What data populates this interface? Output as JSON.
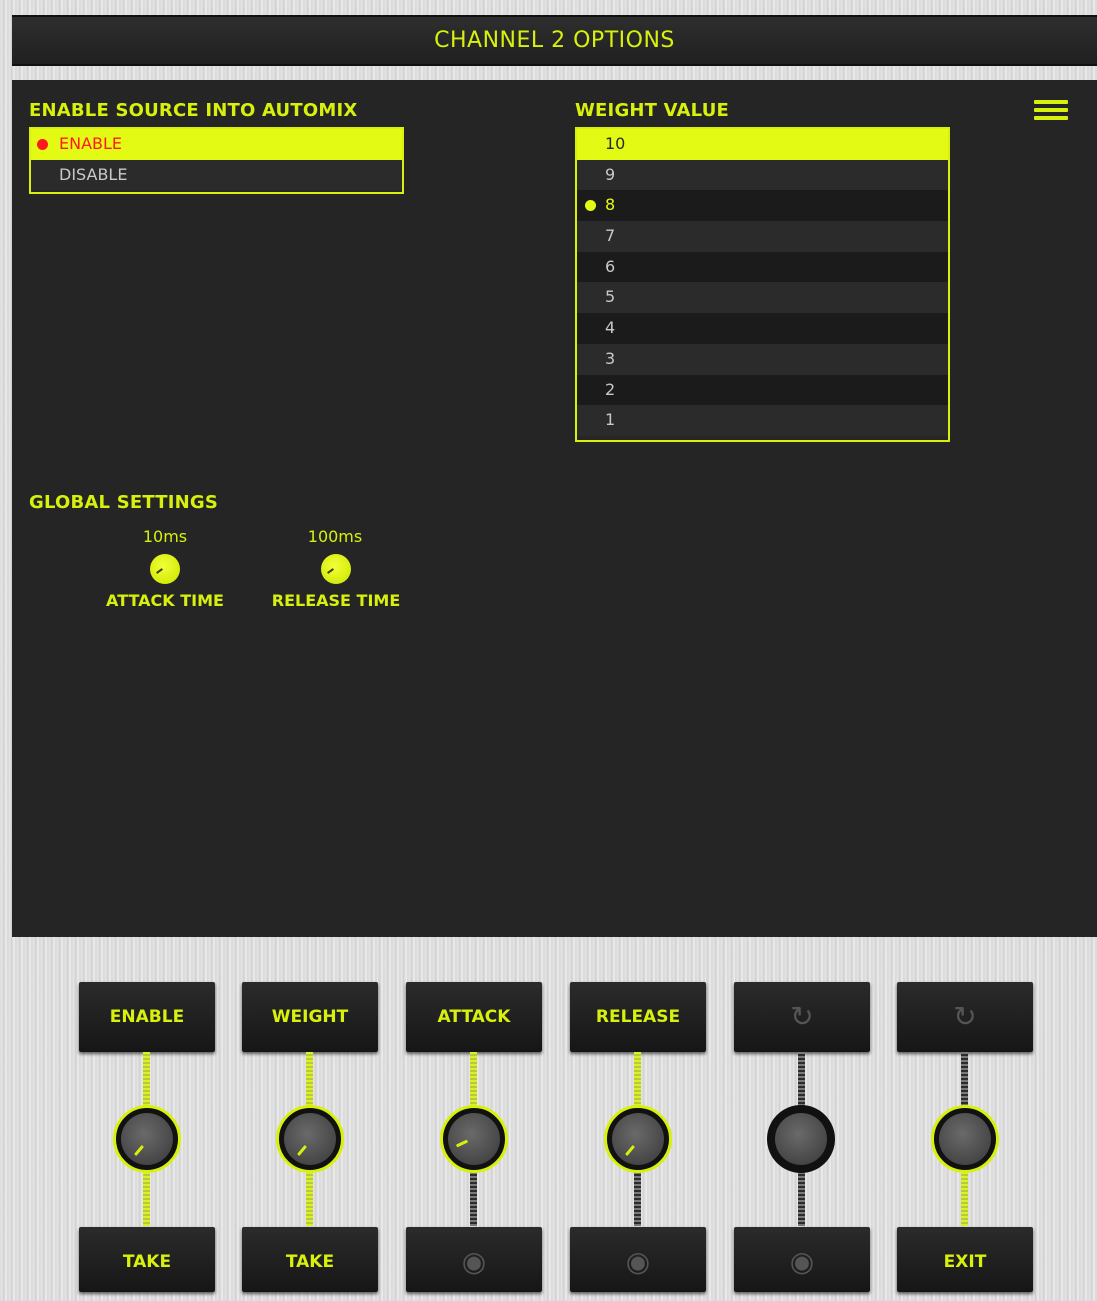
{
  "title": "CHANNEL 2 OPTIONS",
  "colors": {
    "accent": "#d7f10d",
    "panel": "#252525",
    "alert": "#ff1a1a"
  },
  "automix": {
    "heading": "ENABLE SOURCE INTO AUTOMIX",
    "options": [
      {
        "label": "ENABLE",
        "highlighted": true,
        "active": true
      },
      {
        "label": "DISABLE",
        "highlighted": false,
        "active": false
      }
    ]
  },
  "weight": {
    "heading": "WEIGHT VALUE",
    "options": [
      "10",
      "9",
      "8",
      "7",
      "6",
      "5",
      "4",
      "3",
      "2",
      "1"
    ],
    "highlighted": "10",
    "current": "8"
  },
  "global": {
    "heading": "GLOBAL SETTINGS",
    "attack": {
      "value": "10ms",
      "label": "ATTACK TIME"
    },
    "release": {
      "value": "100ms",
      "label": "RELEASE TIME"
    }
  },
  "controls": {
    "top_buttons": [
      "ENABLE",
      "WEIGHT",
      "ATTACK",
      "RELEASE",
      "",
      ""
    ],
    "top_icons": [
      "",
      "",
      "",
      "",
      "refresh-icon",
      "refresh-icon"
    ],
    "bottom_buttons": [
      "TAKE",
      "TAKE",
      "",
      "",
      "",
      "EXIT"
    ],
    "bottom_icons": [
      "",
      "",
      "target-icon",
      "target-icon",
      "target-icon",
      ""
    ]
  }
}
